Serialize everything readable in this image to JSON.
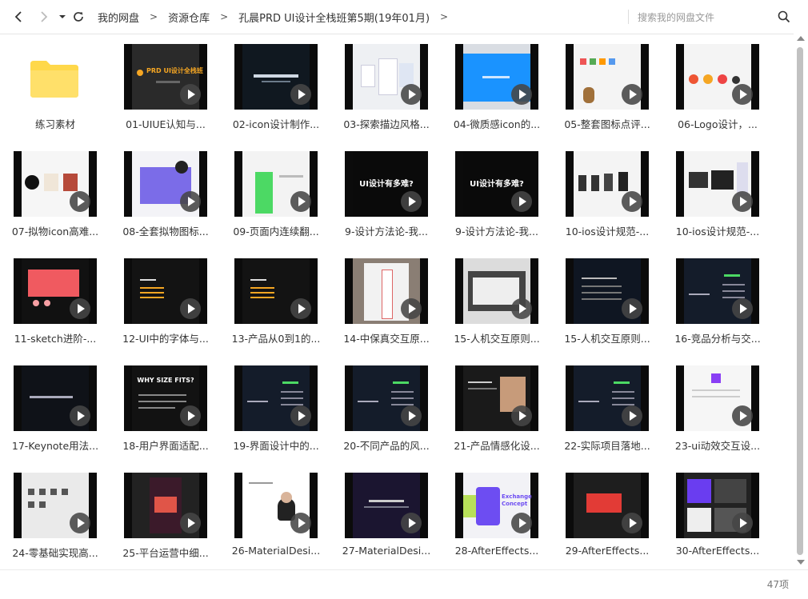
{
  "nav": {
    "back_icon": "chevron-left-icon",
    "forward_icon": "chevron-right-icon",
    "menu_icon": "caret-down-icon",
    "refresh_icon": "refresh-icon"
  },
  "breadcrumb": [
    "我的网盘",
    "资源仓库",
    "孔晨PRD UI设计全栈班第5期(19年01月)"
  ],
  "breadcrumb_separator": ">",
  "search": {
    "placeholder": "搜索我的网盘文件",
    "icon": "search-icon"
  },
  "items": [
    {
      "name": "练习素材",
      "type": "folder"
    },
    {
      "name": "01-UIUE认知与...",
      "type": "video",
      "style": "prd"
    },
    {
      "name": "02-icon设计制作...",
      "type": "video",
      "style": "darktext"
    },
    {
      "name": "03-探索描边风格...",
      "type": "video",
      "style": "app"
    },
    {
      "name": "04-微质感icon的...",
      "type": "video",
      "style": "blue"
    },
    {
      "name": "05-整套图标点评...",
      "type": "video",
      "style": "icons"
    },
    {
      "name": "06-Logo设计，...",
      "type": "video",
      "style": "logos"
    },
    {
      "name": "07-拟物icon高难...",
      "type": "video",
      "style": "cups"
    },
    {
      "name": "08-全套拟物图标...",
      "type": "video",
      "style": "illus"
    },
    {
      "name": "09-页面内连续翻...",
      "type": "video",
      "style": "green"
    },
    {
      "name": "9-设计方法论-我...",
      "type": "video",
      "style": "title",
      "text": "UI设计有多难?"
    },
    {
      "name": "9-设计方法论-我...",
      "type": "video",
      "style": "title",
      "text": "UI设计有多难?"
    },
    {
      "name": "10-ios设计规范-...",
      "type": "video",
      "style": "phones"
    },
    {
      "name": "10-ios设计规范-...",
      "type": "video",
      "style": "devices"
    },
    {
      "name": "11-sketch进阶-...",
      "type": "video",
      "style": "sketch"
    },
    {
      "name": "12-UI中的字体与...",
      "type": "video",
      "style": "outline"
    },
    {
      "name": "13-产品从0到1的...",
      "type": "video",
      "style": "outline"
    },
    {
      "name": "14-中保真交互原...",
      "type": "video",
      "style": "wire"
    },
    {
      "name": "15-人机交互原则...",
      "type": "video",
      "style": "window"
    },
    {
      "name": "15-人机交互原则...",
      "type": "video",
      "style": "darklist"
    },
    {
      "name": "16-竞品分析与交...",
      "type": "video",
      "style": "navy"
    },
    {
      "name": "17-Keynote用法...",
      "type": "video",
      "style": "keynote"
    },
    {
      "name": "18-用户界面适配...",
      "type": "video",
      "style": "whysize",
      "text": "WHY SIZE FITS?"
    },
    {
      "name": "19-界面设计中的...",
      "type": "video",
      "style": "navy"
    },
    {
      "name": "20-不同产品的风...",
      "type": "video",
      "style": "navy"
    },
    {
      "name": "21-产品情感化设...",
      "type": "video",
      "style": "brown"
    },
    {
      "name": "22-实际项目落地...",
      "type": "video",
      "style": "navy"
    },
    {
      "name": "23-ui动效交互设...",
      "type": "video",
      "style": "whitepage"
    },
    {
      "name": "24-零基础实现高...",
      "type": "video",
      "style": "iconsheet"
    },
    {
      "name": "25-平台运营中细...",
      "type": "video",
      "style": "poster"
    },
    {
      "name": "26-MaterialDesi...",
      "type": "video",
      "style": "jobs"
    },
    {
      "name": "27-MaterialDesi...",
      "type": "video",
      "style": "welcome"
    },
    {
      "name": "28-AfterEffects...",
      "type": "video",
      "style": "exchange",
      "text": "Exchange Concept"
    },
    {
      "name": "29-AfterEffects...",
      "type": "video",
      "style": "aered"
    },
    {
      "name": "30-AfterEffects...",
      "type": "video",
      "style": "aeui"
    }
  ],
  "footer": {
    "count": "47项"
  },
  "colors": {
    "folder": "#ffd84a",
    "accent_orange": "#f5a623",
    "blue": "#1a93ff",
    "green": "#4cd964"
  }
}
